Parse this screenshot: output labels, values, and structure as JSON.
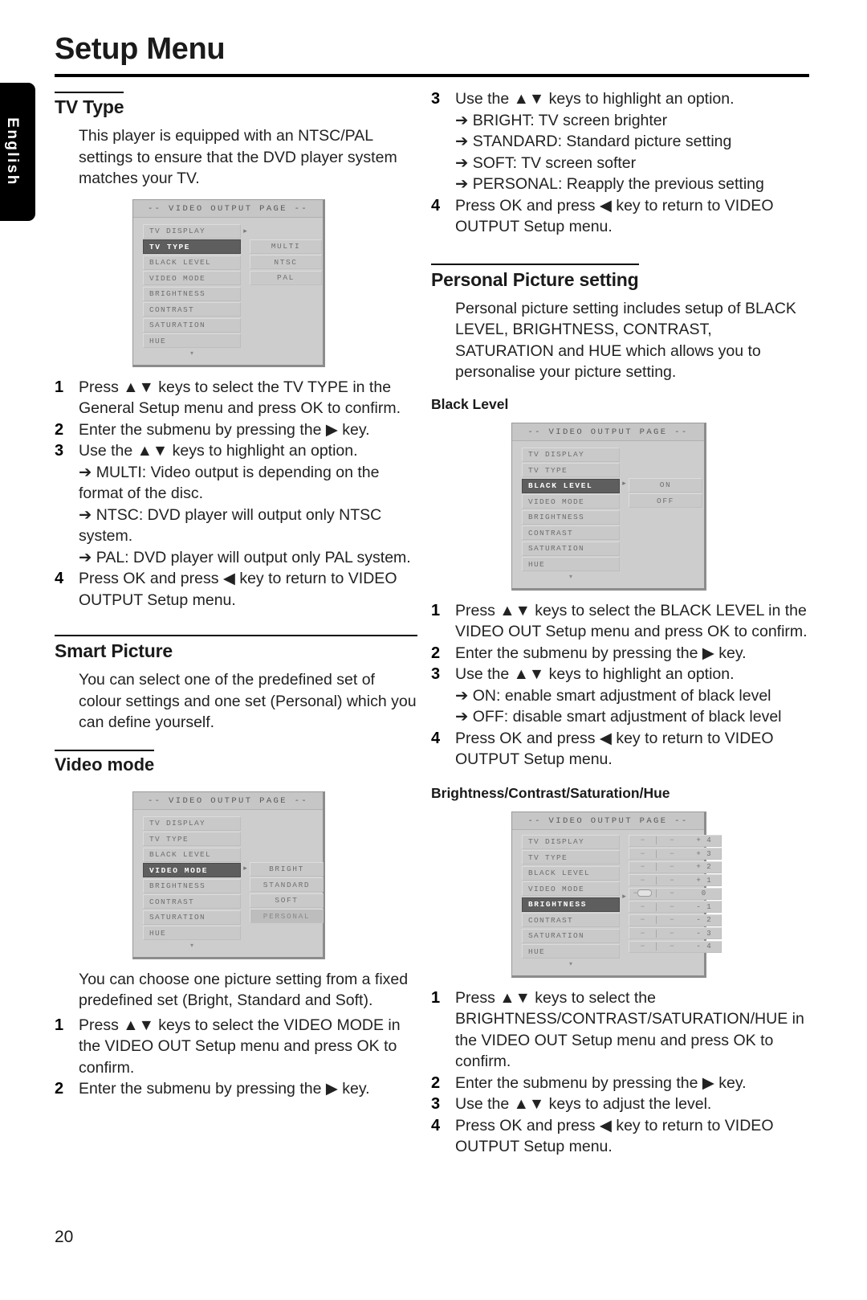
{
  "page": {
    "title": "Setup Menu",
    "language_tab": "English",
    "page_number": "20"
  },
  "left_column": {
    "tv_type": {
      "heading": "TV Type",
      "intro": "This player is equipped with an NTSC/PAL settings to ensure that the DVD player system matches your TV.",
      "osd": {
        "header": "-- VIDEO OUTPUT PAGE --",
        "menu_items": [
          "TV DISPLAY",
          "TV TYPE",
          "BLACK LEVEL",
          "VIDEO MODE",
          "BRIGHTNESS",
          "CONTRAST",
          "SATURATION",
          "HUE"
        ],
        "selected_menu_item": "TV TYPE",
        "options": [
          "MULTI",
          "NTSC",
          "PAL"
        ],
        "highlighted_option": "",
        "scroll_indicator": "▾"
      },
      "steps": [
        {
          "num": "1",
          "text": "Press ▲▼ keys to select the TV TYPE in the General Setup menu and press OK to confirm."
        },
        {
          "num": "2",
          "text": "Enter the submenu by pressing the ▶ key."
        },
        {
          "num": "3",
          "text": "Use the ▲▼ keys to highlight an option."
        }
      ],
      "bullets": [
        "➔ MULTI: Video output is depending on the format of the disc.",
        "➔ NTSC: DVD player will output only NTSC system.",
        "➔ PAL: DVD player will output only PAL system."
      ],
      "final_step": {
        "num": "4",
        "text": "Press OK and press ◀ key to return to VIDEO OUTPUT Setup menu."
      }
    },
    "smart_picture": {
      "heading": "Smart Picture",
      "intro": "You can select one of the predefined set of colour settings and one set (Personal) which you can define yourself.",
      "video_mode": {
        "heading": "Video mode",
        "osd": {
          "header": "-- VIDEO OUTPUT PAGE --",
          "menu_items": [
            "TV DISPLAY",
            "TV TYPE",
            "BLACK LEVEL",
            "VIDEO MODE",
            "BRIGHTNESS",
            "CONTRAST",
            "SATURATION",
            "HUE"
          ],
          "selected_menu_item": "VIDEO MODE",
          "options": [
            "BRIGHT",
            "STANDARD",
            "SOFT",
            "PERSONAL"
          ],
          "highlighted_option": "PERSONAL",
          "scroll_indicator": "▾"
        },
        "description": "You can choose one picture setting from a fixed predefined set (Bright, Standard and Soft).",
        "steps": [
          {
            "num": "1",
            "text": "Press ▲▼ keys to select the VIDEO MODE in the VIDEO OUT Setup menu and press OK to confirm."
          },
          {
            "num": "2",
            "text": "Enter the submenu by pressing the ▶ key."
          }
        ]
      }
    }
  },
  "right_column": {
    "video_mode_continued": {
      "step3": {
        "num": "3",
        "text": "Use the ▲▼ keys to highlight an option."
      },
      "bullets": [
        "➔ BRIGHT: TV screen brighter",
        "➔ STANDARD: Standard picture setting",
        "➔ SOFT: TV screen softer",
        "➔ PERSONAL: Reapply the previous setting"
      ],
      "step4": {
        "num": "4",
        "text": "Press OK and press ◀ key to return to VIDEO OUTPUT Setup menu."
      }
    },
    "personal_picture": {
      "heading": "Personal Picture setting",
      "intro": "Personal picture setting includes setup of BLACK LEVEL, BRIGHTNESS, CONTRAST, SATURATION and HUE which allows you to personalise your picture setting.",
      "black_level": {
        "heading": "Black Level",
        "osd": {
          "header": "-- VIDEO OUTPUT PAGE --",
          "menu_items": [
            "TV DISPLAY",
            "TV TYPE",
            "BLACK LEVEL",
            "VIDEO MODE",
            "BRIGHTNESS",
            "CONTRAST",
            "SATURATION",
            "HUE"
          ],
          "selected_menu_item": "BLACK LEVEL",
          "options": [
            "ON",
            "OFF"
          ],
          "highlighted_option": "",
          "scroll_indicator": "▾"
        },
        "steps": [
          {
            "num": "1",
            "text": "Press ▲▼ keys to select the BLACK LEVEL in the VIDEO OUT Setup menu and press OK to confirm."
          },
          {
            "num": "2",
            "text": "Enter the submenu by pressing the ▶ key."
          },
          {
            "num": "3",
            "text": "Use the ▲▼ keys to highlight an option."
          }
        ],
        "bullets": [
          "➔ ON: enable smart adjustment of black level",
          "➔ OFF: disable smart adjustment of black level"
        ],
        "final_step": {
          "num": "4",
          "text": "Press OK and press ◀ key to return to VIDEO OUTPUT Setup menu."
        }
      },
      "bcsh": {
        "heading": "Brightness/Contrast/Saturation/Hue",
        "osd": {
          "header": "-- VIDEO OUTPUT PAGE --",
          "menu_items": [
            "TV DISPLAY",
            "TV TYPE",
            "BLACK LEVEL",
            "VIDEO MODE",
            "BRIGHTNESS",
            "CONTRAST",
            "SATURATION",
            "HUE"
          ],
          "selected_menu_item": "BRIGHTNESS",
          "level_values": [
            "+ 4",
            "+ 3",
            "+ 2",
            "+ 1",
            "0",
            "- 1",
            "- 2",
            "- 3",
            "- 4"
          ],
          "current_level": "0",
          "scroll_indicator": "▾"
        },
        "steps": [
          {
            "num": "1",
            "text": "Press ▲▼ keys to select the BRIGHTNESS/CONTRAST/SATURATION/HUE in the VIDEO OUT Setup menu and press OK to confirm."
          },
          {
            "num": "2",
            "text": "Enter the submenu by pressing the ▶ key."
          },
          {
            "num": "3",
            "text": "Use the ▲▼ keys to adjust the level."
          },
          {
            "num": "4",
            "text": "Press OK and press ◀ key to return to VIDEO OUTPUT Setup menu."
          }
        ]
      }
    }
  }
}
